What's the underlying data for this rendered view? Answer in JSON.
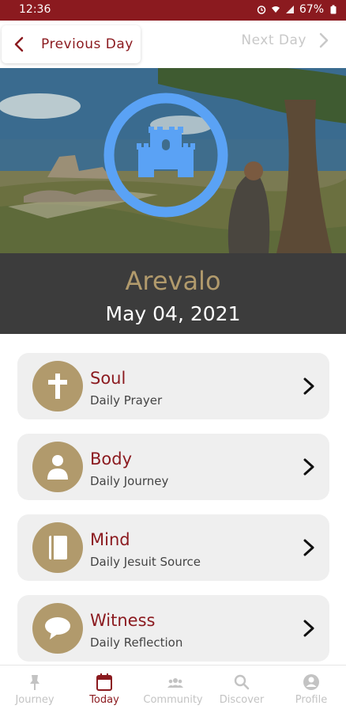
{
  "status_bar": {
    "time": "12:36",
    "battery": "67%"
  },
  "nav": {
    "previous_label": "Previous Day",
    "next_label": "Next Day"
  },
  "hero": {
    "place": "Arevalo",
    "date": "May 04, 2021"
  },
  "cards": [
    {
      "title": "Soul",
      "subtitle": "Daily Prayer",
      "icon": "cross-icon"
    },
    {
      "title": "Body",
      "subtitle": "Daily Journey",
      "icon": "person-icon"
    },
    {
      "title": "Mind",
      "subtitle": "Daily Jesuit Source",
      "icon": "book-icon"
    },
    {
      "title": "Witness",
      "subtitle": "Daily Reflection",
      "icon": "speech-bubble-icon"
    }
  ],
  "tabs": [
    {
      "label": "Journey",
      "icon": "pin-icon",
      "active": false
    },
    {
      "label": "Today",
      "icon": "calendar-icon",
      "active": true
    },
    {
      "label": "Community",
      "icon": "group-icon",
      "active": false
    },
    {
      "label": "Discover",
      "icon": "search-icon",
      "active": false
    },
    {
      "label": "Profile",
      "icon": "user-icon",
      "active": false
    }
  ],
  "colors": {
    "brand": "#8b1a1f",
    "gold": "#b19a6c",
    "accent_blue": "#5aa2f5"
  }
}
